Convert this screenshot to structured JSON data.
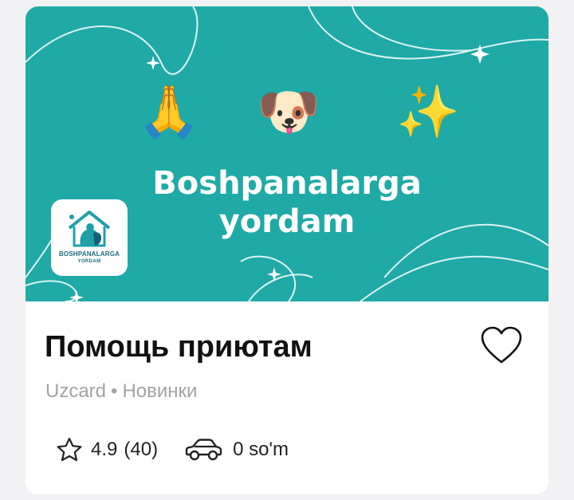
{
  "banner": {
    "emojis": {
      "pray": "🙏",
      "dog": "🐶",
      "sparkles": "✨"
    },
    "title_line1": "Boshpanalarga",
    "title_line2": "yordam",
    "background_color": "#1faaa6",
    "logo": {
      "icon": "shelter-house-icon",
      "line1": "BOSHPANALARGA",
      "line2": "YORDAM"
    }
  },
  "card": {
    "title": "Помощь приютам",
    "provider": "Uzcard",
    "separator": "•",
    "category": "Новинки",
    "favorite_icon": "heart-outline-icon",
    "rating": "4.9",
    "rating_count": "(40)",
    "delivery_icon": "car-icon",
    "delivery_price": "0 so'm"
  }
}
